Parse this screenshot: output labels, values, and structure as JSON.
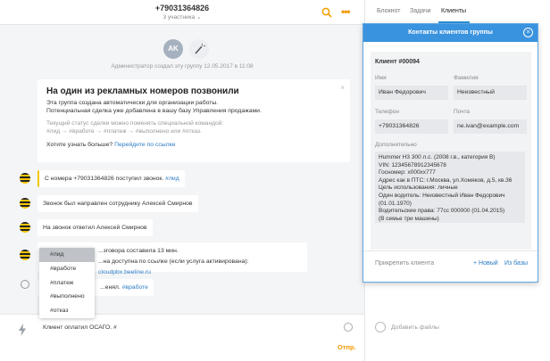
{
  "header": {
    "phone": "+79031364826",
    "participants": "3 участника ⌄"
  },
  "avatar_initials": "AK",
  "created_note": "Администратор создал эту группу 12.05.2017 в 11:08",
  "info_card": {
    "title": "На один из рекламных номеров позвонили",
    "line1": "Эта группа создана автоматически для организации работы.",
    "line2": "Потенциальная сделка уже добавлена в вашу базу Управления продажами.",
    "hint1": "Текущий статус сделки можно поменять специальной командой:",
    "hint2": "#лид → #вработе → #платеж → #выполнено или #отказ.",
    "more_text": "Хотите узнать больше?",
    "more_link": "Перейдите по ссылке",
    "close": "×"
  },
  "messages": {
    "m1_text": "С номера +79031364826 поступил звонок. ",
    "m1_tag": "#лид",
    "m2": "Звонок был направлен сотруднику Алексей Смирнов",
    "m3": "На звонок ответил Алексей Смирнов",
    "m4_line1": "...зговора составила 13 мин.",
    "m4_line2_text": "...на доступна по ссылке (если услуга активирована): ",
    "m4_link": "cloudpbx.beeline.ru",
    "m5_text": "...енял. ",
    "m5_tag": "#вработе"
  },
  "tag_dropdown": [
    "#лид",
    "#вработе",
    "#платеж",
    "#выполнено",
    "#отказ"
  ],
  "input": {
    "value": "Клиент оплатил ОСАГО. #",
    "send": "Отпр."
  },
  "tabs": [
    "Блокнот",
    "Задачи",
    "Клиенты"
  ],
  "add_files": "Добавить файлы",
  "popup": {
    "title": "Контакты клиентов группы",
    "client_id": "Клиент #00094",
    "labels": {
      "first_name": "Имя",
      "last_name": "Фамилия",
      "phone": "Телефон",
      "email": "Почта",
      "extra": "Дополнительно"
    },
    "values": {
      "first_name": "Иван Федорович",
      "last_name": "Неизвестный",
      "phone": "+79031364826",
      "email": "ne.ivan@example.com"
    },
    "notes": [
      "Hummer H3 300 л.с. (2008 г.в., категория В)",
      "VIN: 12345678912345678",
      "Госномер: х000хх777",
      "Адрес как в ПТС: г.Москва, ул.Хомяков, д.5, кв.36",
      "Цель использования: личные",
      "Один водитель: Неизвестный Иван Федорович",
      "(01.01.1970)",
      "Водительские права: 77сс 000000 (01.04.2015)",
      "(В семье три машины)"
    ],
    "attach": "Прикрепить клиента",
    "new": "+ Новый",
    "from_base": "Из базы"
  },
  "colors": {
    "accent_orange": "#f29b00",
    "accent_blue": "#3a93de",
    "link_blue": "#2a7ac3"
  }
}
